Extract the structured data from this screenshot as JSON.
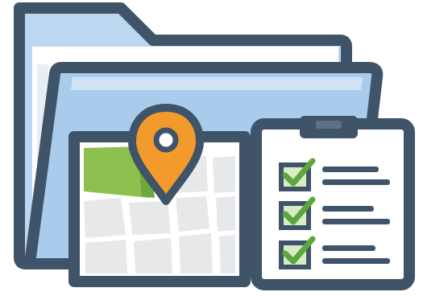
{
  "illustration": {
    "icons": [
      "folder-icon",
      "map-icon",
      "location-pin-icon",
      "clipboard-icon",
      "checkbox-check-icon"
    ],
    "colors": {
      "outline": "#3f5468",
      "folder_back": "#bcd7ef",
      "folder_front": "#a9ccec",
      "folder_highlight": "#cfe3f5",
      "paper": "#ffffff",
      "paper_shadow": "#e7eef4",
      "map_land": "#e6e8ea",
      "map_green": "#8dc04f",
      "map_green_dark": "#6fa83a",
      "pin": "#f39a2c",
      "check_box": "#d9ecc6",
      "check_mark": "#5da53f"
    },
    "checklist": {
      "items_checked": [
        true,
        true,
        true
      ]
    }
  }
}
